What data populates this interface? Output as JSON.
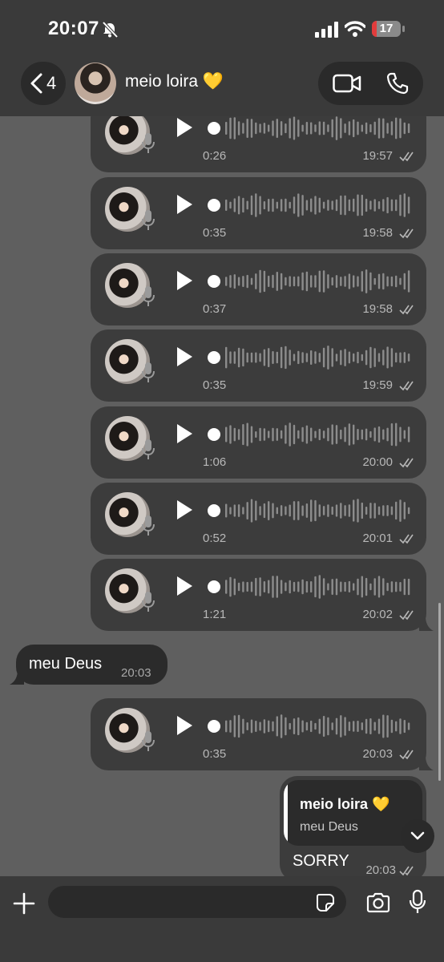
{
  "status_bar": {
    "time": "20:07",
    "battery": "17",
    "battery_fraction": 0.17
  },
  "header": {
    "back_count": "4",
    "contact_name": "meio loira 💛"
  },
  "voice_messages": [
    {
      "duration": "0:26",
      "time": "19:57"
    },
    {
      "duration": "0:35",
      "time": "19:58"
    },
    {
      "duration": "0:37",
      "time": "19:58"
    },
    {
      "duration": "0:35",
      "time": "19:59"
    },
    {
      "duration": "1:06",
      "time": "20:00"
    },
    {
      "duration": "0:52",
      "time": "20:01"
    },
    {
      "duration": "1:21",
      "time": "20:02"
    },
    {
      "duration": "0:35",
      "time": "20:03"
    }
  ],
  "incoming_message": {
    "text": "meu Deus",
    "time": "20:03"
  },
  "reply_message": {
    "quoted_author": "meio loira 💛",
    "quoted_text": "meu Deus",
    "text": "SORRY",
    "time": "20:03"
  },
  "composer": {
    "placeholder": ""
  },
  "icons": {
    "mute": "bell-slash-icon",
    "signal": "cellular-signal-icon",
    "wifi": "wifi-icon",
    "back": "chevron-left-icon",
    "video": "video-camera-icon",
    "call": "phone-icon",
    "play": "play-icon",
    "mic": "microphone-icon",
    "read": "double-check-icon",
    "scroll": "chevron-down-icon",
    "attach": "plus-icon",
    "sticker": "sticker-icon",
    "camera": "camera-icon"
  },
  "colors": {
    "background": "#5f5f5f",
    "bars": "#3a3a3a",
    "outgoing_bubble": "#3c3c3c",
    "incoming_bubble": "#2b2b2b",
    "battery_low": "#e23c3c"
  }
}
